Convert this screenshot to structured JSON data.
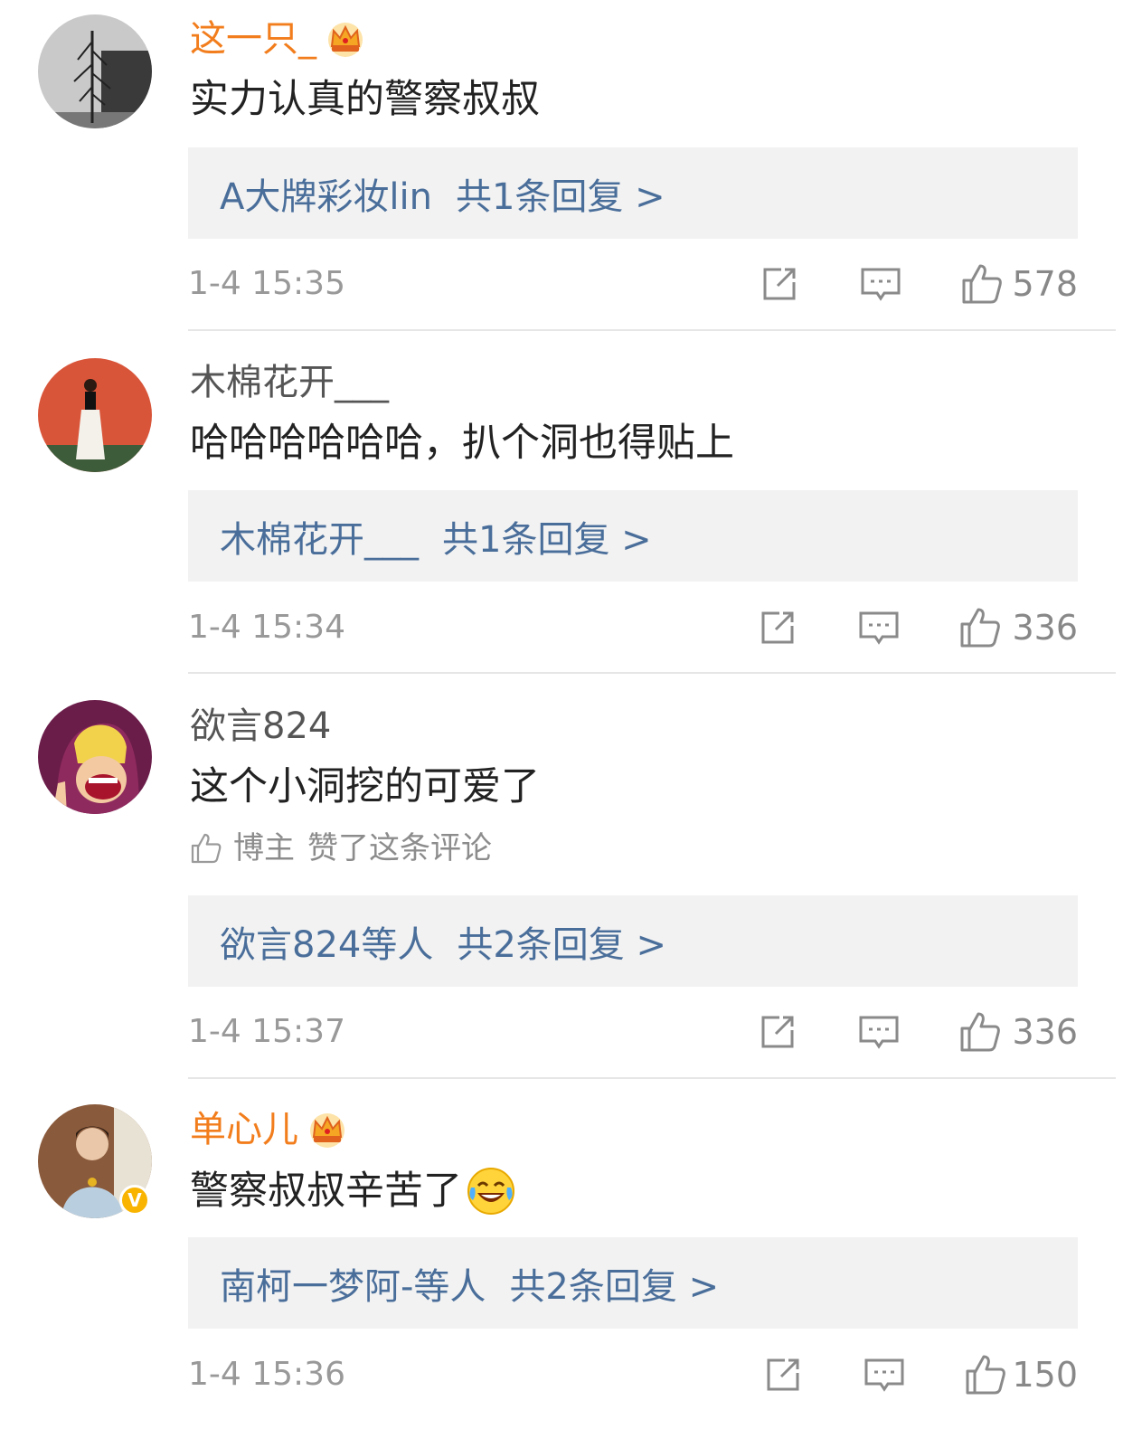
{
  "comments": [
    {
      "username": "这一只_",
      "vip": true,
      "text": "实力认真的警察叔叔",
      "reply_users": "A大牌彩妆lin",
      "reply_count": "共1条回复 >",
      "time": "1-4 15:35",
      "likes": "578"
    },
    {
      "username": "木棉花开___",
      "vip": false,
      "text": "哈哈哈哈哈哈，扒个洞也得贴上",
      "reply_users": "木棉花开___",
      "reply_count": "共1条回复 >",
      "time": "1-4 15:34",
      "likes": "336"
    },
    {
      "username": "欲言824",
      "vip": false,
      "text": "这个小洞挖的可爱了",
      "liked_by": "博主",
      "liked_note": "赞了这条评论",
      "reply_users": "欲言824等人",
      "reply_count": "共2条回复 >",
      "time": "1-4 15:37",
      "likes": "336"
    },
    {
      "username": "单心儿",
      "vip": true,
      "verified": true,
      "verified_mark": "V",
      "text": "警察叔叔辛苦了",
      "emoji": "laugh-cry-emoji",
      "reply_users": "南柯一梦阿-等人",
      "reply_count": "共2条回复 >",
      "time": "1-4 15:36",
      "likes": "150"
    }
  ],
  "colors": {
    "vip_name": "#f27d1c",
    "name": "#555555",
    "reply_link": "#4a6e9a",
    "reply_bg": "#f2f2f2",
    "meta": "#999999",
    "icon": "#8a8a8a"
  },
  "icons": {
    "share": "share-icon",
    "comment": "comment-icon",
    "like": "thumbs-up-icon",
    "crown": "vip-crown-icon"
  }
}
